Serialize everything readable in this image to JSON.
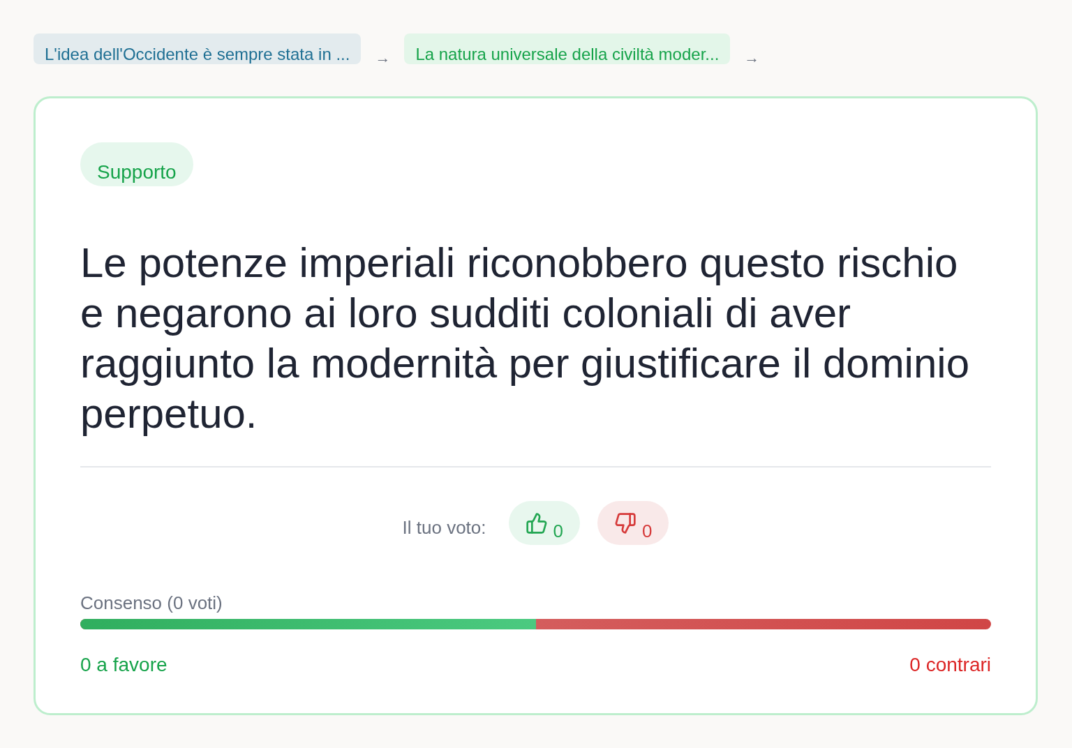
{
  "breadcrumbs": [
    {
      "label": "L'idea dell'Occidente è sempre stata in ...",
      "kind": "neutral",
      "arrow": "→"
    },
    {
      "label": "La natura universale della civiltà moder...",
      "kind": "support",
      "arrow": "→"
    }
  ],
  "card": {
    "tag": {
      "label": "Supporto",
      "kind": "support"
    },
    "statement": "Le potenze imperiali riconobbero questo rischio e negarono ai loro sudditi coloniali di aver raggiunto la modernità per giustificare il dominio perpetuo.",
    "vote": {
      "label": "Il tuo voto:",
      "buttons": [
        {
          "kind": "up",
          "count": "0"
        },
        {
          "kind": "down",
          "count": "0"
        }
      ]
    },
    "consensus": {
      "label": "Consenso (0 voti)",
      "level": 0.5,
      "for_label": "0 a favore",
      "against_label": "0 contrari"
    }
  }
}
